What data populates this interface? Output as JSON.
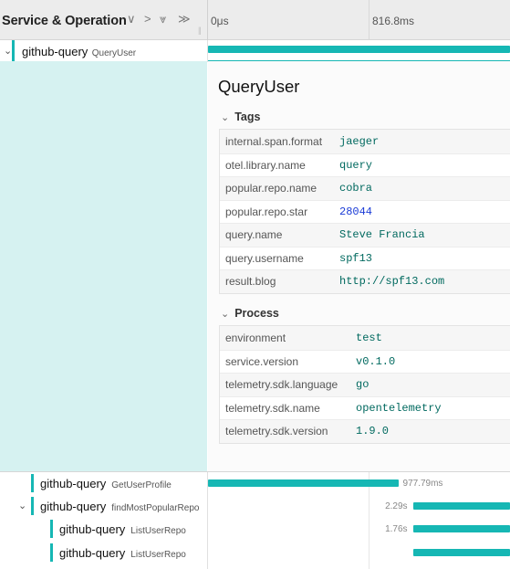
{
  "header": {
    "title": "Service & Operation",
    "controls": {
      "collapse_one": "∨",
      "expand_one": ">",
      "collapse_all": "⩔",
      "expand_all": "≫",
      "grip": "||"
    },
    "ticks": [
      "0μs",
      "816.8ms"
    ]
  },
  "root_span": {
    "service": "github-query",
    "operation": "QueryUser"
  },
  "detail": {
    "title": "QueryUser",
    "tags_label": "Tags",
    "tags": [
      {
        "key": "internal.span.format",
        "value": "jaeger",
        "type": "string"
      },
      {
        "key": "otel.library.name",
        "value": "query",
        "type": "string"
      },
      {
        "key": "popular.repo.name",
        "value": "cobra",
        "type": "string"
      },
      {
        "key": "popular.repo.star",
        "value": "28044",
        "type": "number"
      },
      {
        "key": "query.name",
        "value": "Steve Francia",
        "type": "string"
      },
      {
        "key": "query.username",
        "value": "spf13",
        "type": "string"
      },
      {
        "key": "result.blog",
        "value": "http://spf13.com",
        "type": "string"
      }
    ],
    "process_label": "Process",
    "process": [
      {
        "key": "environment",
        "value": "test"
      },
      {
        "key": "service.version",
        "value": "v0.1.0"
      },
      {
        "key": "telemetry.sdk.language",
        "value": "go"
      },
      {
        "key": "telemetry.sdk.name",
        "value": "opentelemetry"
      },
      {
        "key": "telemetry.sdk.version",
        "value": "1.9.0"
      }
    ]
  },
  "child_spans": [
    {
      "service": "github-query",
      "operation": "GetUserProfile",
      "duration": "977.79ms",
      "start_fraction": 0.0,
      "width_fraction": 0.63,
      "has_children": false
    },
    {
      "service": "github-query",
      "operation": "findMostPopularRepo",
      "duration": "2.29s",
      "start_fraction": 0.68,
      "width_fraction": 0.32,
      "has_children": true
    },
    {
      "service": "github-query",
      "operation": "ListUserRepo",
      "duration": "1.76s",
      "start_fraction": 0.68,
      "width_fraction": 0.32,
      "has_children": false
    },
    {
      "service": "github-query",
      "operation": "ListUserRepo",
      "duration": "",
      "start_fraction": 0.68,
      "width_fraction": 0.32,
      "has_children": false
    }
  ],
  "colors": {
    "accent": "#16b7b4",
    "detail_bg": "#d6f2f1",
    "tag_value": "#00695f",
    "tag_number": "#1a3bd6"
  }
}
